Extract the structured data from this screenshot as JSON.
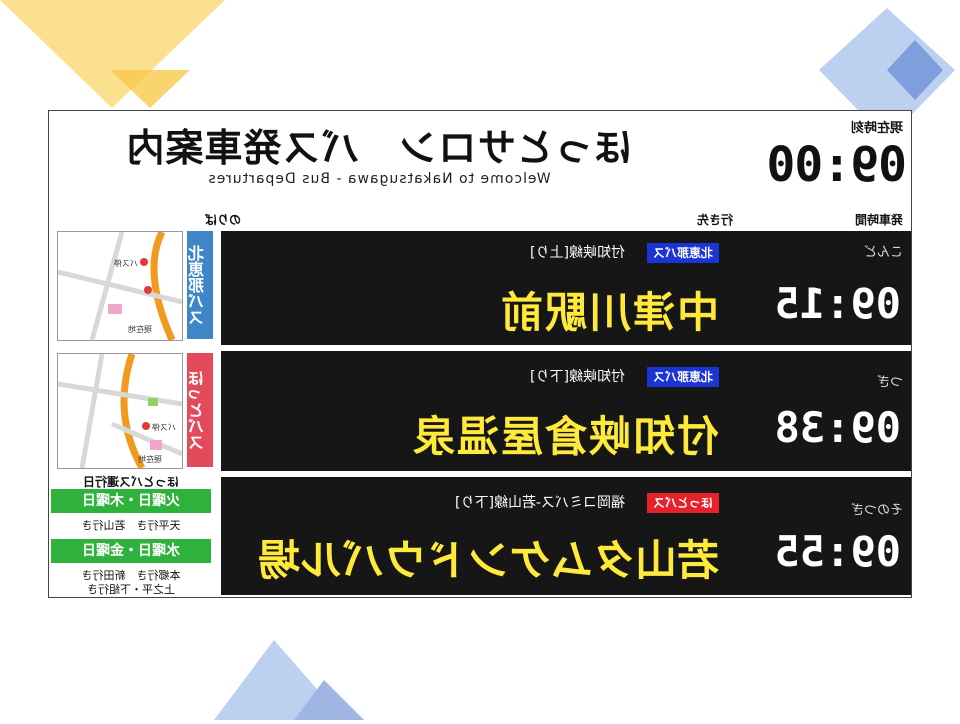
{
  "clock": {
    "label": "現在時刻",
    "time": "09:00"
  },
  "header": {
    "title": "ほっとサロン　バス発車案内",
    "subtitle": "Welcome to Nakatsugawa - Bus Departures"
  },
  "columns": {
    "departure": "発車時間",
    "destination": "行き先",
    "route_map": "のりば"
  },
  "departures": [
    {
      "order": "こんど",
      "time": "09:15",
      "operator": "北恵那バス",
      "operator_color": "#1a34d6",
      "line": "付知峡線[上り]",
      "destination": "中津川駅前"
    },
    {
      "order": "つぎ",
      "time": "09:38",
      "operator": "北恵那バス",
      "operator_color": "#1a34d6",
      "line": "付知峡線[下り]",
      "destination": "付知峡倉屋温泉"
    },
    {
      "order": "そのつぎ",
      "time": "09:55",
      "operator": "ほっとバス",
      "operator_color": "#e8202a",
      "line": "福岡コミバス-若山線[下り]",
      "destination": "若山タムケンドウバル場"
    }
  ],
  "maps": [
    {
      "tag": "北恵那バス",
      "tag_color": "#3f86c8",
      "labels": [
        "バス停",
        "現在地"
      ]
    },
    {
      "tag": "ほっとバス",
      "tag_color": "#e34b5b",
      "labels": [
        "バス停",
        "現在地"
      ]
    }
  ],
  "service": {
    "title": "ほっとバス運行日",
    "groups": [
      {
        "days": "火曜日・木曜日",
        "dests": [
          "天平行き　若山行き"
        ]
      },
      {
        "days": "水曜日・金曜日",
        "dests": [
          "本郷行き　新田行き",
          "上之平・下組行き"
        ]
      }
    ]
  },
  "colors": {
    "board_bg": "#161616",
    "destination_text": "#ffe93a",
    "service_green": "#2fb13d"
  }
}
